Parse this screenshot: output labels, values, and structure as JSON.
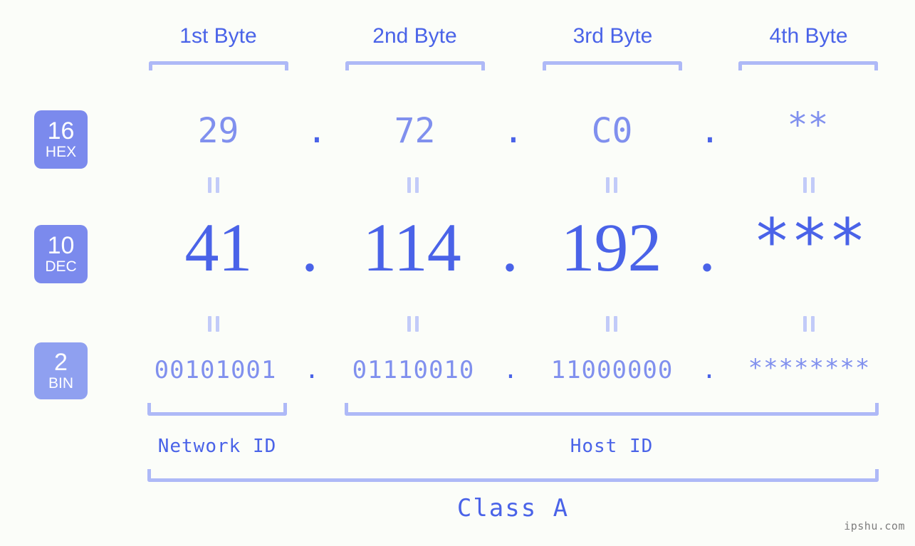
{
  "page": {
    "background_color": "#fbfdf9",
    "accent_color": "#4a63e8",
    "accent_light_color": "#8090ee",
    "bracket_color": "#aeb9f7",
    "badge_color": "#7b8aed",
    "badge_color_light": "#8fa0f0",
    "watermark": "ipshu.com"
  },
  "byte_headers": [
    {
      "label": "1st Byte"
    },
    {
      "label": "2nd Byte"
    },
    {
      "label": "3rd Byte"
    },
    {
      "label": "4th Byte"
    }
  ],
  "radix_rows": [
    {
      "badge_number": "16",
      "badge_name": "HEX",
      "values": [
        "29",
        "72",
        "C0",
        "**"
      ],
      "separator": "."
    },
    {
      "badge_number": "10",
      "badge_name": "DEC",
      "values": [
        "41",
        "114",
        "192",
        "***"
      ],
      "separator": "."
    },
    {
      "badge_number": "2",
      "badge_name": "BIN",
      "values": [
        "00101001",
        "01110010",
        "11000000",
        "********"
      ],
      "separator": "."
    }
  ],
  "equality_symbol": "=",
  "id_sections": [
    {
      "label": "Network ID"
    },
    {
      "label": "Host ID"
    }
  ],
  "class_label": "Class A"
}
